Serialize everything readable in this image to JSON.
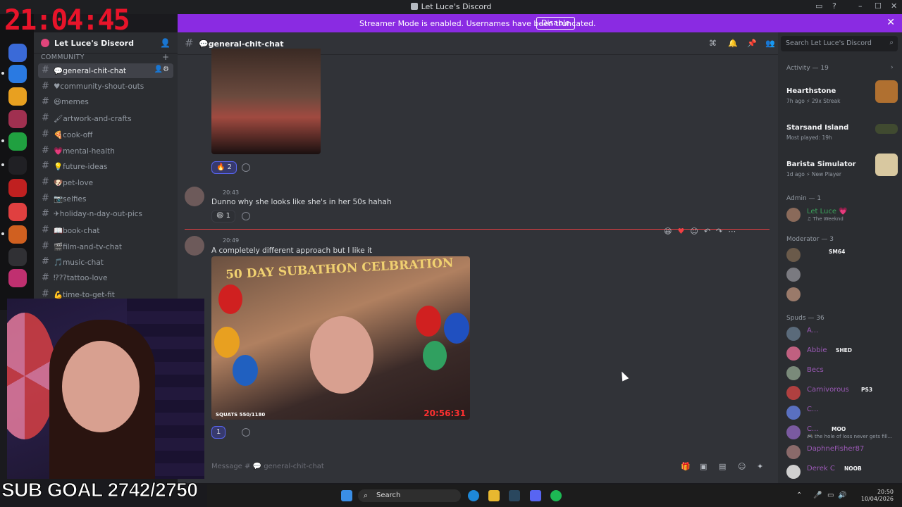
{
  "window": {
    "title": "Let Luce's Discord",
    "minimize": "–",
    "maximize": "☐",
    "close": "✕"
  },
  "banner": {
    "text": "Streamer Mode is enabled. Usernames have been truncated.",
    "button": "Disable",
    "close": "✕"
  },
  "server": {
    "name": "Let Luce's Discord",
    "category": "COMMUNITY",
    "channels": [
      {
        "name": "💬general-chit-chat",
        "active": true
      },
      {
        "name": "♥community-shout-outs"
      },
      {
        "name": "😆memes"
      },
      {
        "name": "🖌artwork-and-crafts"
      },
      {
        "name": "🍕cook-off"
      },
      {
        "name": "💗mental-health"
      },
      {
        "name": "💡future-ideas"
      },
      {
        "name": "🐶pet-love"
      },
      {
        "name": "📷selfies"
      },
      {
        "name": "✈holiday-n-day-out-pics"
      },
      {
        "name": "📖book-chat"
      },
      {
        "name": "🎬film-and-tv-chat"
      },
      {
        "name": "🎵music-chat"
      },
      {
        "name": "⁉??tattoo-love"
      },
      {
        "name": "💪time-to-get-fit"
      }
    ]
  },
  "channel_header": {
    "name": "💬general-chit-chat",
    "search_placeholder": "Search Let Luce's Discord"
  },
  "messages": [
    {
      "reactions": [
        {
          "emoji": "🔥",
          "count": "2",
          "me": true
        }
      ]
    },
    {
      "time": "20:43",
      "text": "Dunno why she looks like she's in her 50s hahah",
      "reactions": [
        {
          "emoji": "😆",
          "count": "1"
        }
      ]
    },
    {
      "time": "20:49",
      "text": "A completely different approach but I like it",
      "image_text": {
        "banner": "50 DAY SUBATHON CELBRATION",
        "squats": "SQUATS 550/1180",
        "timer": "20:56:31"
      },
      "reactions": [
        {
          "emoji": "",
          "count": "1",
          "me": true
        }
      ]
    }
  ],
  "composer": {
    "placeholder": "Message # 💬 general-chit-chat"
  },
  "members": {
    "activity_header": "Activity — 19",
    "activities": [
      {
        "title": "Hearthstone",
        "sub": "7h ago  ⚡ 29x Streak"
      },
      {
        "title": "Starsand Island",
        "sub": "Most played: 19h"
      },
      {
        "title": "Barista Simulator",
        "sub": "1d ago  ⚡ New Player"
      }
    ],
    "admin_header": "Admin — 1",
    "admin": {
      "name": "Let Luce 💗",
      "sub": "♫ The Weeknd",
      "color": "#3ba55c"
    },
    "moderator_header": "Moderator — 3",
    "moderator_tag": "SM64",
    "spuds_header": "Spuds — 36",
    "spuds": [
      {
        "name": "A...",
        "tag": ""
      },
      {
        "name": "Abbie",
        "tag": "SHED"
      },
      {
        "name": "Becs",
        "tag": ""
      },
      {
        "name": "Carnivorous",
        "tag": "PS3"
      },
      {
        "name": "C...",
        "tag": ""
      },
      {
        "name": "C...",
        "tag": "MOO",
        "sub": "🎮 the hole of loss never gets fill..."
      },
      {
        "name": "DaphneFisher87",
        "tag": ""
      },
      {
        "name": "Derek C",
        "tag": "NOOB"
      }
    ],
    "name_color": "#9b59b6"
  },
  "overlay": {
    "clock": "21:04:45",
    "sub_goal": "SUB GOAL 2742/2750"
  },
  "taskbar": {
    "search": "Search",
    "time": "20:50",
    "date": "10/04/2026"
  },
  "colors": {
    "banner": "#8a2be2",
    "accent": "#5865f2",
    "new_marker": "#f23f43"
  }
}
